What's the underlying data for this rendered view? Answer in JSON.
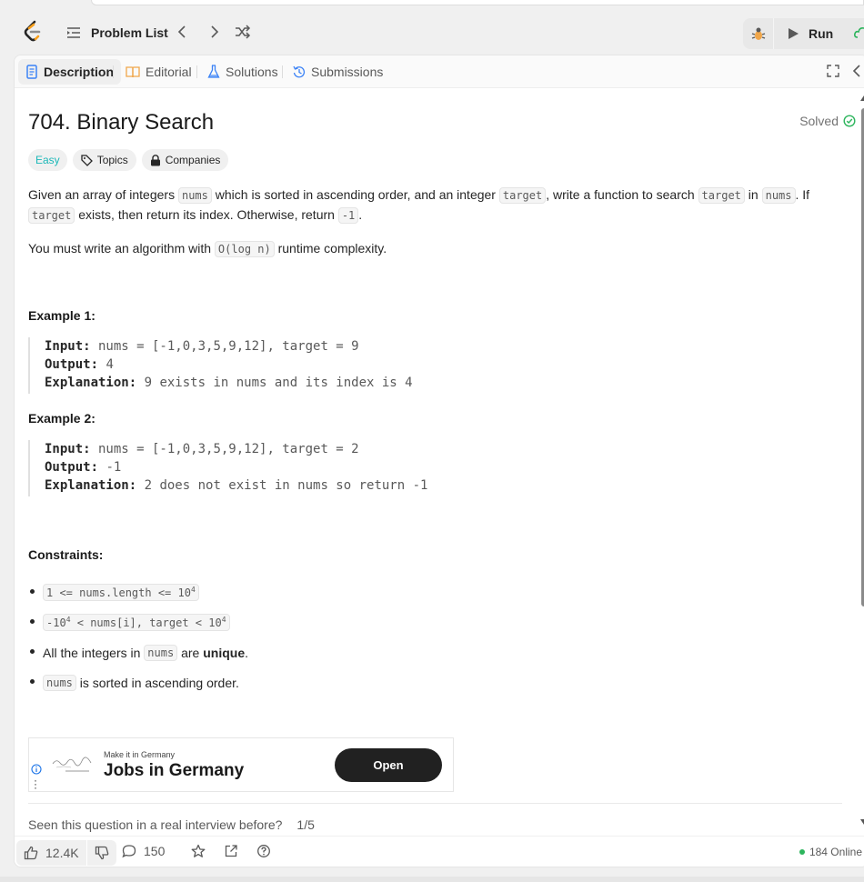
{
  "navbar": {
    "problem_list_label": "Problem List",
    "run_label": "Run"
  },
  "tabs": {
    "description": "Description",
    "editorial": "Editorial",
    "solutions": "Solutions",
    "submissions": "Submissions"
  },
  "problem": {
    "title": "704. Binary Search",
    "solved_label": "Solved",
    "difficulty": "Easy",
    "topics_label": "Topics",
    "companies_label": "Companies",
    "desc_1": "Given an array of integers ",
    "code_nums": "nums",
    "desc_2": " which is sorted in ascending order, and an integer ",
    "code_target": "target",
    "desc_3": ", write a function to search ",
    "desc_4": " in ",
    "desc_5": ". If ",
    "desc_6": " exists, then return its index. Otherwise, return ",
    "code_neg1": "-1",
    "desc_7": ".",
    "complexity_1": "You must write an algorithm with ",
    "complexity_code": "O(log n)",
    "complexity_2": " runtime complexity."
  },
  "examples": [
    {
      "heading": "Example 1:",
      "input_label": "Input:",
      "input": " nums = [-1,0,3,5,9,12], target = 9",
      "output_label": "Output:",
      "output": " 4",
      "explanation_label": "Explanation:",
      "explanation": " 9 exists in nums and its index is 4"
    },
    {
      "heading": "Example 2:",
      "input_label": "Input:",
      "input": " nums = [-1,0,3,5,9,12], target = 2",
      "output_label": "Output:",
      "output": " -1",
      "explanation_label": "Explanation:",
      "explanation": " 2 does not exist in nums so return -1"
    }
  ],
  "constraints": {
    "heading": "Constraints:",
    "c1_code": "1 <= nums.length <= 10",
    "c1_exp": "4",
    "c2_code_a": "-10",
    "c2_exp_a": "4",
    "c2_code_b": " < nums[i], target < 10",
    "c2_exp_b": "4",
    "c3_a": "All the integers in ",
    "c3_code": "nums",
    "c3_b": " are ",
    "c3_bold": "unique",
    "c3_c": ".",
    "c4_code": "nums",
    "c4_text": " is sorted in ascending order."
  },
  "ad": {
    "small_text": "Make it in Germany",
    "big_text": "Jobs in Germany",
    "open_label": "Open"
  },
  "seen": {
    "question": "Seen this question in a real interview before?",
    "counter": "1/5"
  },
  "footer": {
    "likes": "12.4K",
    "comments": "150",
    "online": "184 Online"
  },
  "colors": {
    "easy": "#1cb8b8",
    "solved": "#2db55d",
    "online_dot": "#2db55d",
    "run_bg": "#e8e8e8"
  }
}
